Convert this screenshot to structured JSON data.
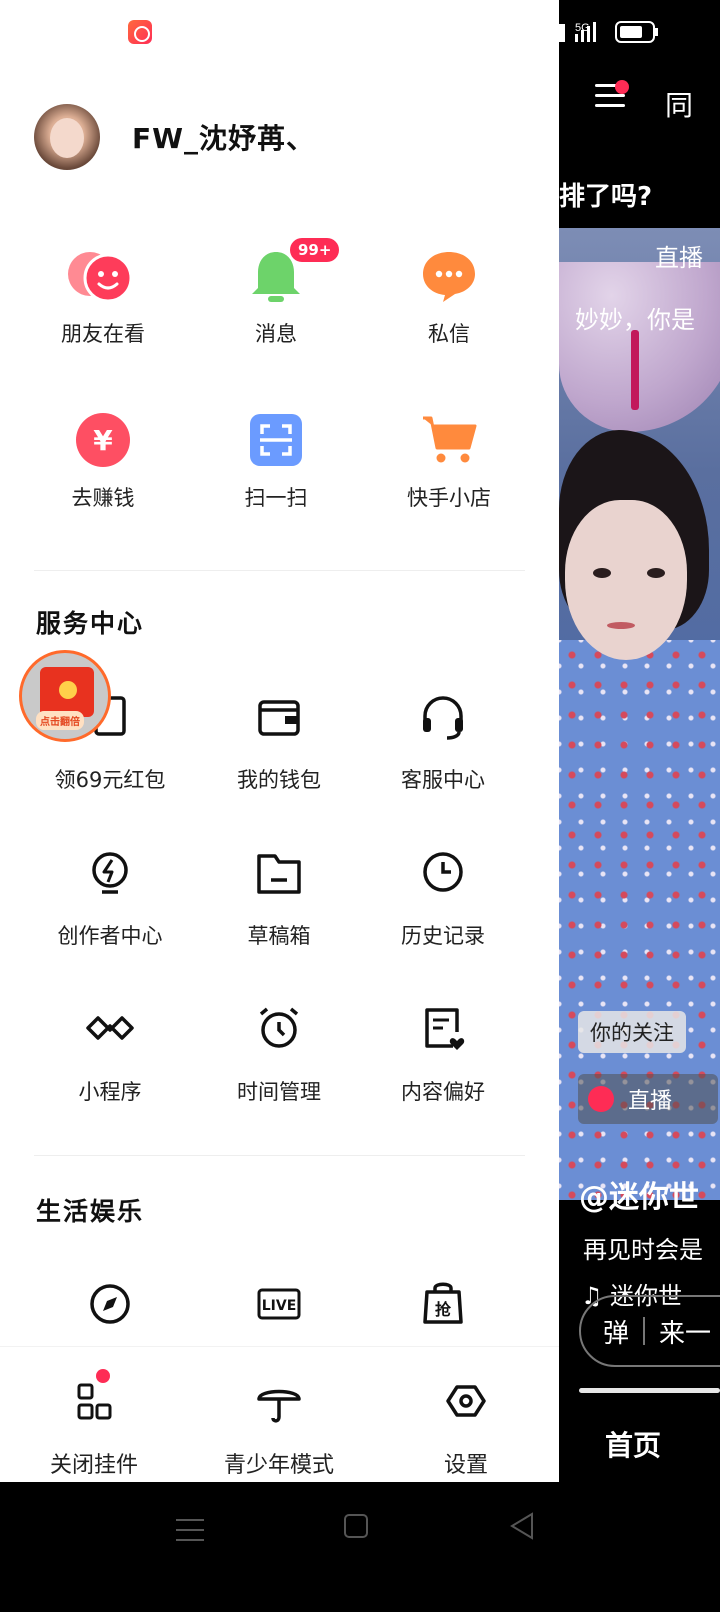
{
  "status_bar": {
    "network": "5G"
  },
  "profile": {
    "username": "FW_沈妤苒、"
  },
  "quick_actions": [
    {
      "label": "朋友在看",
      "icon": "friends-watching-icon"
    },
    {
      "label": "消息",
      "icon": "bell-icon",
      "badge": "99+"
    },
    {
      "label": "私信",
      "icon": "chat-bubble-icon"
    },
    {
      "label": "去赚钱",
      "icon": "yuan-coin-icon"
    },
    {
      "label": "扫一扫",
      "icon": "scan-icon"
    },
    {
      "label": "快手小店",
      "icon": "shopping-cart-icon"
    }
  ],
  "service_center": {
    "title": "服务中心",
    "items": [
      {
        "label": "领69元红包",
        "icon": "red-packet-icon"
      },
      {
        "label": "我的钱包",
        "icon": "wallet-icon"
      },
      {
        "label": "客服中心",
        "icon": "headset-icon"
      },
      {
        "label": "创作者中心",
        "icon": "lightbulb-icon"
      },
      {
        "label": "草稿箱",
        "icon": "folder-icon"
      },
      {
        "label": "历史记录",
        "icon": "clock-icon"
      },
      {
        "label": "小程序",
        "icon": "infinity-icon"
      },
      {
        "label": "时间管理",
        "icon": "alarm-icon"
      },
      {
        "label": "内容偏好",
        "icon": "document-heart-icon"
      }
    ],
    "red_packet_float": {
      "tag": "点击翻倍"
    }
  },
  "life_entertainment": {
    "title": "生活娱乐",
    "items": [
      {
        "icon": "compass-icon"
      },
      {
        "icon": "live-icon",
        "text": "LIVE"
      },
      {
        "icon": "grab-bag-icon",
        "text": "抢"
      }
    ]
  },
  "bottom_bar": [
    {
      "label": "关闭挂件",
      "icon": "widget-icon"
    },
    {
      "label": "青少年模式",
      "icon": "umbrella-icon"
    },
    {
      "label": "设置",
      "icon": "settings-hex-icon"
    }
  ],
  "background_video": {
    "top_tab": "同",
    "question": "排了吗?",
    "live_label": "直播",
    "bubble": "妙妙，你是",
    "follow_chip": "你的关注",
    "live_chip": "直播",
    "author": "@迷你世",
    "caption": "再见时会是",
    "music": "♫  迷你世",
    "danmu": "弹",
    "danmu_hint": "来一",
    "home_tab": "首页"
  }
}
